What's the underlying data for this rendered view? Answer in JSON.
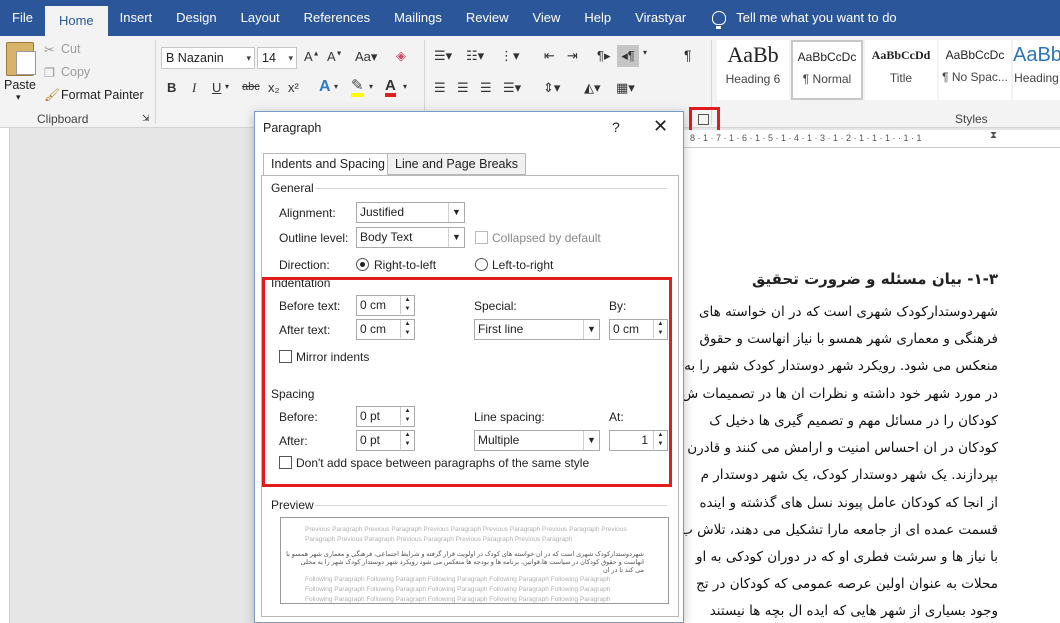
{
  "menu": {
    "items": [
      "File",
      "Home",
      "Insert",
      "Design",
      "Layout",
      "References",
      "Mailings",
      "Review",
      "View",
      "Help",
      "Virastyar"
    ],
    "active": "Home",
    "tell_me": "Tell me what you want to do"
  },
  "ribbon": {
    "clipboard": {
      "paste": "Paste",
      "cut": "Cut",
      "copy": "Copy",
      "format_painter": "Format Painter",
      "label": "Clipboard"
    },
    "font": {
      "name": "B Nazanin",
      "size": "14",
      "bold": "B",
      "italic": "I",
      "underline": "U",
      "strike": "abc",
      "subscript": "x₂",
      "superscript": "x²"
    },
    "styles": {
      "label": "Styles",
      "items": [
        {
          "preview": "AaBb",
          "name": "Heading 6"
        },
        {
          "preview": "AaBbCcDc",
          "name": "¶ Normal"
        },
        {
          "preview": "AaBbCcDd",
          "name": "Title"
        },
        {
          "preview": "AaBbCcDc",
          "name": "¶ No Spac..."
        },
        {
          "preview": "AaBb",
          "name": "Heading"
        }
      ]
    }
  },
  "dialog": {
    "title": "Paragraph",
    "help": "?",
    "close": "✕",
    "tabs": [
      "Indents and Spacing",
      "Line and Page Breaks"
    ],
    "general": {
      "label": "General",
      "alignment_label": "Alignment:",
      "alignment": "Justified",
      "outline_label": "Outline level:",
      "outline": "Body Text",
      "collapsed": "Collapsed by default",
      "direction_label": "Direction:",
      "rtl": "Right-to-left",
      "ltr": "Left-to-right"
    },
    "indentation": {
      "label": "Indentation",
      "before_label": "Before text:",
      "before": "0 cm",
      "after_label": "After text:",
      "after": "0 cm",
      "special_label": "Special:",
      "special": "First line",
      "by_label": "By:",
      "by": "0 cm",
      "mirror": "Mirror indents"
    },
    "spacing": {
      "label": "Spacing",
      "before_label": "Before:",
      "before": "0 pt",
      "after_label": "After:",
      "after": "0 pt",
      "line_label": "Line spacing:",
      "line": "Multiple",
      "at_label": "At:",
      "at": "1",
      "dont_add": "Don't add space between paragraphs of the same style"
    },
    "preview": {
      "label": "Preview",
      "prev1": "Previous Paragraph Previous Paragraph Previous Paragraph Previous Paragraph Previous Paragraph Previous",
      "prev2": "Paragraph Previous Paragraph Previous Paragraph Previous Paragraph Previous Paragraph",
      "cur1": "شهردوستدارکودک شهری است که در ان خواسته های کودک در اولویت قرار گرفته و شرایط اجتماعی، فرهنگی و معماری شهر همسو با",
      "cur2": "انهاست و حقوق کودکان در سیاست ها،قوانین، برنامه ها و بودجه ها منعکس می شود رویکرد شهر دوستدار کودک شهر را به محلی",
      "cur3": "می کند تا در ان",
      "fol": "Following Paragraph Following Paragraph Following Paragraph Following Paragraph Following Paragraph"
    }
  },
  "document": {
    "heading": "۱-۳- بیان مسئله و ضرورت تحقیق",
    "lines": [
      "شهردوستدارکودک شهری است که در ان خواسته های",
      "فرهنگی و معماری شهر همسو با نیاز انهاست و حقوق",
      "منعکس می شود. رویکرد شهر دوستدار کودک شهر را به",
      "در مورد شهر خود داشته و نظرات ان ها در تصمیمات ش",
      "کودکان را در مسائل مهم و تصمیم گیری ها دخیل ک",
      "کودکان در ان احساس امنیت و ارامش می کنند و قادرن",
      "بپردازند. یک شهر دوستدار کودک، یک شهر دوستدار م",
      "از انجا که کودکان عامل پیوند نسل های گذشته و اینده",
      "قسمت عمده ای از جامعه مارا تشکیل می دهند، تلاش ب",
      "با نیاز ها و سرشت فطری او که در دوران کودکی به او",
      "محلات به عنوان اولین عرصه عمومی که کودکان در تج",
      "وجود بسیاری از شهر هایی که ایده ال بچه ها نیستند"
    ]
  }
}
